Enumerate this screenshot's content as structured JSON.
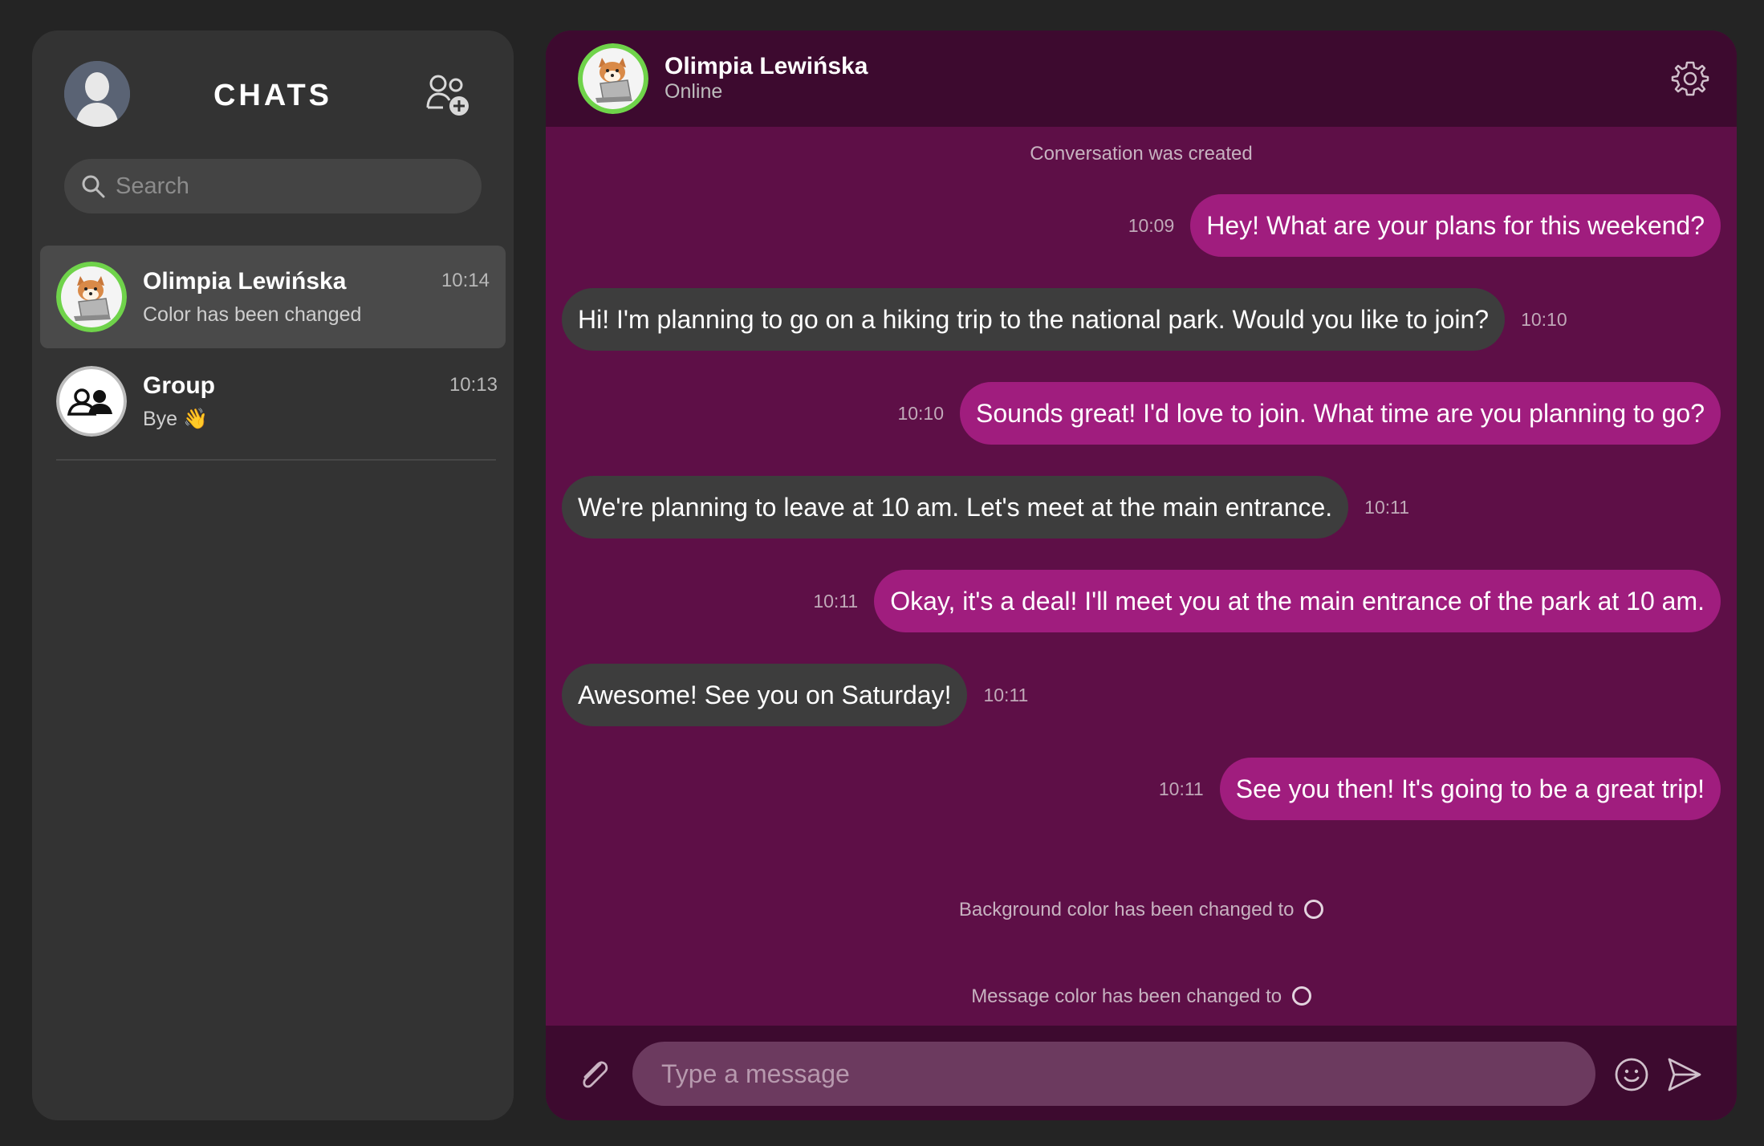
{
  "sidebar": {
    "title": "CHATS",
    "search": {
      "placeholder": "Search",
      "value": ""
    },
    "chats": [
      {
        "name": "Olimpia Lewińska",
        "preview": "Color has been changed",
        "time": "10:14",
        "active": true
      },
      {
        "name": "Group",
        "preview": "Bye 👋",
        "time": "10:13",
        "active": false
      }
    ]
  },
  "conversation": {
    "contact_name": "Olimpia Lewińska",
    "contact_status": "Online",
    "system_created": "Conversation was created",
    "messages": [
      {
        "direction": "out",
        "text": "Hey! What are your plans for this weekend?",
        "time": "10:09"
      },
      {
        "direction": "in",
        "text": "Hi! I'm planning to go on a hiking trip to the national park. Would you like to join?",
        "time": "10:10"
      },
      {
        "direction": "out",
        "text": "Sounds great! I'd love to join. What time are you planning to go?",
        "time": "10:10"
      },
      {
        "direction": "in",
        "text": "We're planning to leave at 10 am. Let's meet at the main entrance.",
        "time": "10:11"
      },
      {
        "direction": "out",
        "text": "Okay, it's a deal! I'll meet you at the main entrance of the park at 10 am.",
        "time": "10:11"
      },
      {
        "direction": "in",
        "text": "Awesome! See you on Saturday!",
        "time": "10:11"
      },
      {
        "direction": "out",
        "text": "See you then! It's going to be a great trip!",
        "time": "10:11"
      }
    ],
    "system_bg_changed": "Background color has been changed to",
    "system_msg_changed": "Message color has been changed to",
    "composer_placeholder": "Type a message"
  },
  "colors": {
    "sidebar_bg": "#333333",
    "active_chat_bg": "#4a4a4a",
    "conversation_bg": "#5e0f47",
    "header_bg": "#3d0a2f",
    "outgoing_bubble": "#a01d7e",
    "incoming_bubble": "#3d3d3d",
    "online_ring": "#6fd34a"
  },
  "icons": {
    "add_contact": "add-contact-icon",
    "search": "search-icon",
    "settings": "gear-icon",
    "attach": "paperclip-icon",
    "emoji": "smiley-icon",
    "send": "send-icon"
  }
}
